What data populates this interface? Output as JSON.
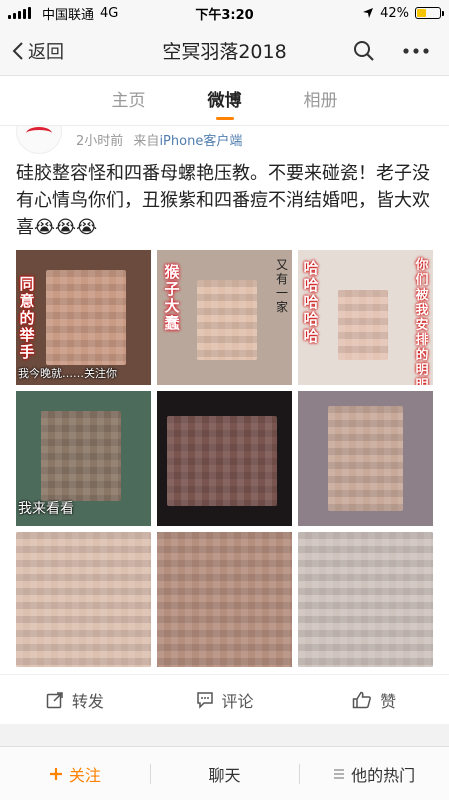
{
  "status_bar": {
    "carrier": "中国联通",
    "network": "4G",
    "time": "下午3:20",
    "battery": "42%",
    "battery_level": 0.42
  },
  "nav": {
    "back_label": "返回",
    "title": "空冥羽落2018",
    "icons": [
      "chevron-left-icon",
      "search-icon",
      "more-icon"
    ]
  },
  "tabs": [
    {
      "label": "主页"
    },
    {
      "label": "微博"
    },
    {
      "label": "相册"
    }
  ],
  "post": {
    "time": "2小时前",
    "source_prefix": "来自",
    "source": "iPhone客户端",
    "text": "硅胶整容怪和四番母螺艳压教。不要来碰瓷！老子没有心情鸟你们，丑猴紫和四番痘不消结婚吧，皆大欢喜😭😭😭",
    "images": [
      {
        "bg": "#6b4b3d",
        "face": "#c99b85",
        "caption": "我今晚就……关注你",
        "vertical": "同意的举手"
      },
      {
        "bg": "#b9a79b",
        "face": "#e1c0ad",
        "caption": "",
        "vertical": "猴子大蠢"
      },
      {
        "bg": "#e5dcd6",
        "face": "#e4c4b4",
        "caption": "",
        "vertical": "你们被我安排的明明白白"
      },
      {
        "bg": "#4d6b5a",
        "face": "#8a7766",
        "caption": "我来看看",
        "vertical": ""
      },
      {
        "bg": "#1b1617",
        "face": "#7a5550",
        "caption": "",
        "vertical": ""
      },
      {
        "bg": "#8d8089",
        "face": "#c8a99a",
        "caption": "",
        "vertical": ""
      },
      {
        "bg": "#f1ebe7",
        "face": "#dcc0b0",
        "caption": "",
        "vertical": ""
      },
      {
        "bg": "#6e6460",
        "face": "#b58f7e",
        "caption": "",
        "vertical": ""
      },
      {
        "bg": "#dfe0e3",
        "face": "#cfc3bd",
        "caption": "",
        "vertical": ""
      }
    ],
    "overlay_texts": [
      "又有一家",
      "哈哈哈哈哈"
    ]
  },
  "actions": [
    {
      "label": "转发",
      "icon": "share-icon"
    },
    {
      "label": "评论",
      "icon": "comment-icon"
    },
    {
      "label": "赞",
      "icon": "like-icon"
    }
  ],
  "bottom_bar": {
    "follow_label": "关注",
    "chat_label": "聊天",
    "hot_label": "他的热门"
  },
  "colors": {
    "accent": "#ff8200",
    "link": "#507daf"
  }
}
